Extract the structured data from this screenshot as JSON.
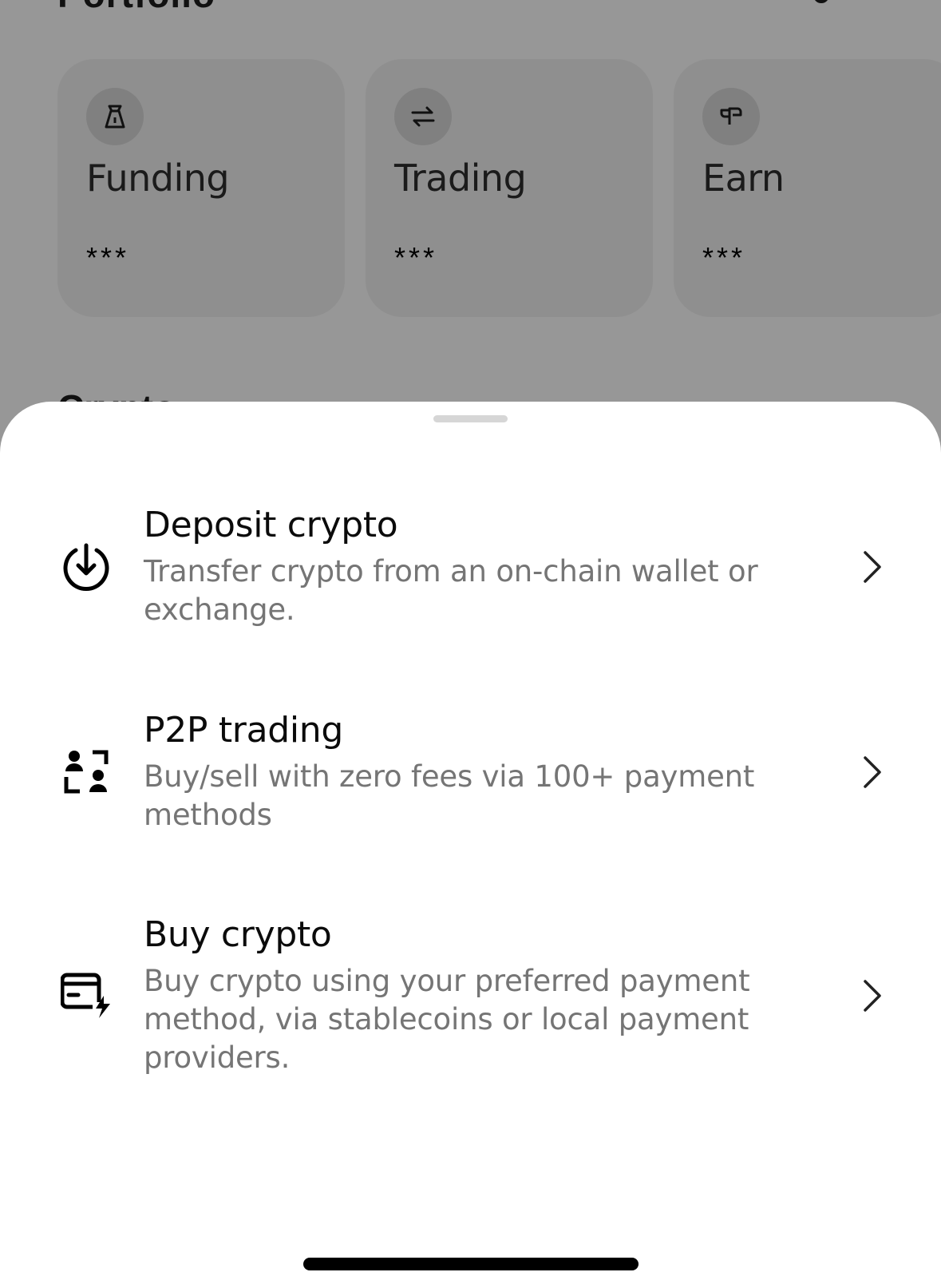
{
  "background": {
    "title": "Portfolio",
    "section_label": "Crypto",
    "cards": [
      {
        "label": "Funding",
        "value": "***",
        "icon": "funding-bag-icon"
      },
      {
        "label": "Trading",
        "value": "***",
        "icon": "swap-arrows-icon"
      },
      {
        "label": "Earn",
        "value": "***",
        "icon": "earn-sprout-icon"
      }
    ]
  },
  "sheet": {
    "options": [
      {
        "title": "Deposit crypto",
        "description": "Transfer crypto from an on-chain wallet or exchange.",
        "icon": "deposit-download-icon"
      },
      {
        "title": "P2P trading",
        "description": "Buy/sell with zero fees via 100+ payment methods",
        "icon": "p2p-users-icon"
      },
      {
        "title": "Buy crypto",
        "description": "Buy crypto using your preferred payment method, via stablecoins or local payment providers.",
        "icon": "card-lightning-icon"
      }
    ]
  },
  "colors": {
    "overlay_background": "#979797",
    "card_background": "#8f8f8f",
    "sheet_background": "#ffffff",
    "title_text": "#0b0b0b",
    "description_text": "#757575"
  }
}
